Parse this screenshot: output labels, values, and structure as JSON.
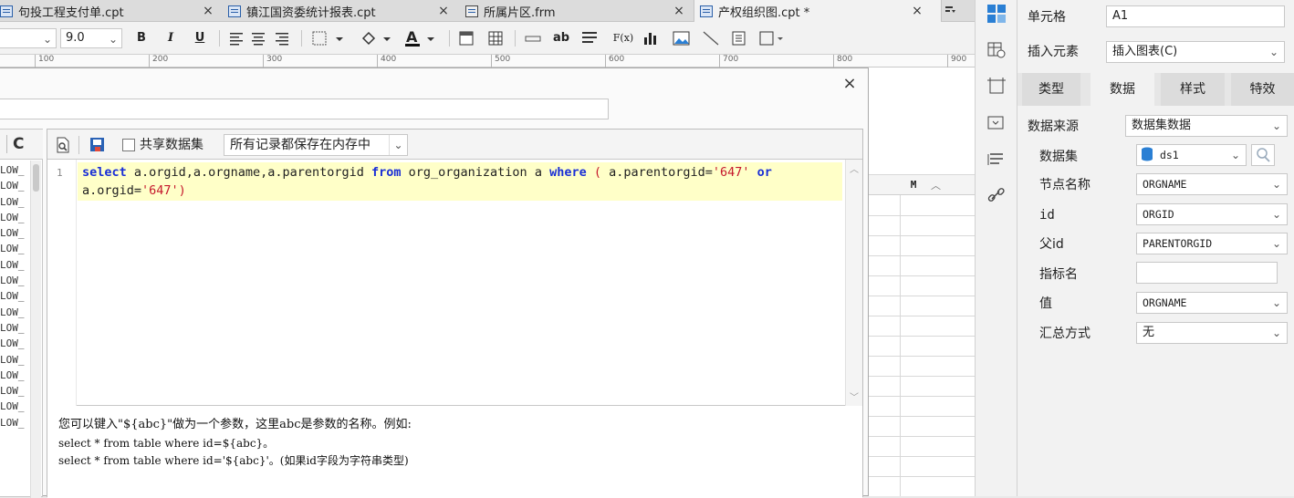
{
  "tabs": [
    {
      "label": "句投工程支付单.cpt",
      "close": "×"
    },
    {
      "label": "镇江国资委统计报表.cpt",
      "close": "×"
    },
    {
      "label": "所属片区.frm",
      "close": "×"
    },
    {
      "label": "产权组织图.cpt *",
      "close": "×"
    }
  ],
  "toolbar": {
    "font_size": "9.0",
    "bold": "B",
    "italic": "I",
    "underline": "U",
    "text_btn": "ab",
    "formula_btn": "F(x)"
  },
  "ruler": [
    "100",
    "200",
    "300",
    "400",
    "500",
    "600",
    "700",
    "800",
    "900"
  ],
  "dialog": {
    "close": "×",
    "name_value": "",
    "left_rows": [
      "LOW_",
      "LOW_",
      "LOW_",
      "LOW_",
      "LOW_",
      "LOW_",
      "LOW_",
      "LOW_",
      "LOW_",
      "LOW_",
      "LOW_",
      "LOW_",
      "LOW_",
      "LOW_",
      "LOW_",
      "LOW_",
      "LOW_"
    ],
    "refresh": "C",
    "share_label": "共享数据集",
    "memory_option": "所有记录都保存在内存中",
    "line_number": "1",
    "sql": {
      "kw_select": "select",
      "part1": " a.orgid,a.orgname,a.parentorgid ",
      "kw_from": "from",
      "part2": " org_organization a ",
      "kw_where": "where",
      "paren_open": " (",
      "part3": " a.parentorgid=",
      "str1": "'647'",
      "kw_or": " or",
      "part4": "a.orgid=",
      "str2": "'647'",
      "paren_close": ")"
    },
    "hint": [
      "您可以键入\"${abc}\"做为一个参数，这里abc是参数的名称。例如:",
      "select * from table where id=${abc}。",
      "select * from table where id='${abc}'。(如果id字段为字符串类型)"
    ]
  },
  "sheet": {
    "col_header": "M"
  },
  "right_panel": {
    "cell_label": "单元格",
    "cell_value": "A1",
    "insert_label": "插入元素",
    "insert_value": "插入图表(C)",
    "tabs": [
      "类型",
      "数据",
      "样式",
      "特效"
    ],
    "active_tab": "数据",
    "source_label": "数据来源",
    "source_value": "数据集数据",
    "dataset_label": "数据集",
    "dataset_value": "ds1",
    "node_label": "节点名称",
    "node_value": "ORGNAME",
    "id_label": "id",
    "id_value": "ORGID",
    "pid_label": "父id",
    "pid_value": "PARENTORGID",
    "metric_label": "指标名",
    "metric_value": "",
    "value_label": "值",
    "value_value": "ORGNAME",
    "agg_label": "汇总方式",
    "agg_value": "无"
  },
  "colors": {
    "accent": "#1a2fd6",
    "string": "#c5182c",
    "highlight": "#ffffc8",
    "icon_blue": "#2a7fd4"
  }
}
